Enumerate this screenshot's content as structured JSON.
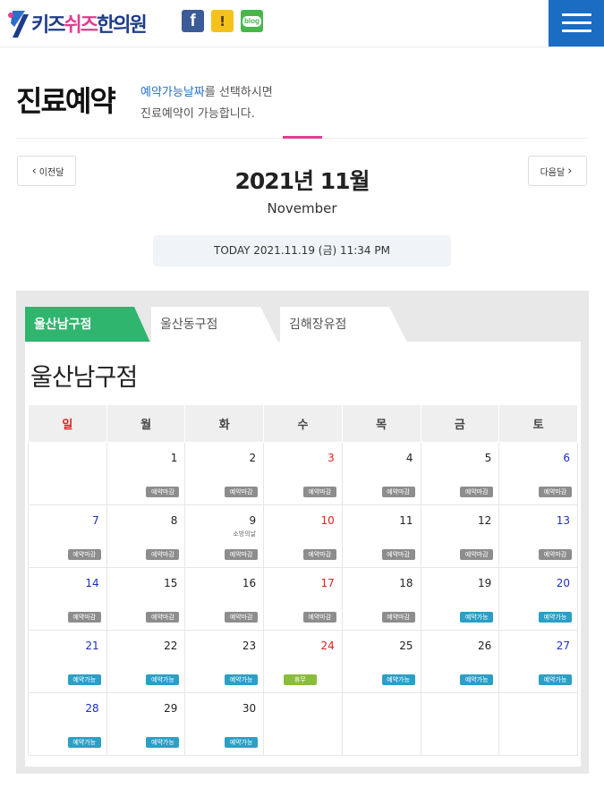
{
  "header": {
    "logo_a": "키즈",
    "logo_b": "쉬즈",
    "logo_c": "한의원",
    "facebook_glyph": "f",
    "story_glyph": "!",
    "blog_label": "blog",
    "icons": [
      "facebook-icon",
      "kakaostory-icon",
      "blog-icon",
      "hamburger-menu-icon"
    ],
    "brand_color": "#1f3c8a",
    "accent_color": "#e23c8e",
    "menu_color": "#1b6cc3"
  },
  "title": {
    "heading": "진료예약",
    "desc_highlight": "예약가능날짜",
    "desc_rest": "를 선택하시면",
    "desc_line2": "진료예약이 가능합니다."
  },
  "nav": {
    "prev_label": "이전달",
    "next_label": "다음달",
    "prev_icon": "chevron-left-icon",
    "next_icon": "chevron-right-icon",
    "month_title": "2021년 11월",
    "month_en": "November",
    "today": "TODAY 2021.11.19 (금) 11:34 PM"
  },
  "tabs": [
    {
      "label": "울산남구점",
      "active": true
    },
    {
      "label": "울산동구점",
      "active": false
    },
    {
      "label": "김해장유점",
      "active": false
    }
  ],
  "branch_title": "울산남구점",
  "weekdays": [
    "일",
    "월",
    "화",
    "수",
    "목",
    "금",
    "토"
  ],
  "status_labels": {
    "closed": "예약마감",
    "available": "예약가능",
    "off": "휴무"
  },
  "colors": {
    "available": "#2b9fc6",
    "closed": "#8d8d8d",
    "off": "#8bbd3c",
    "sunday": "#e02020",
    "saturday": "#1b2fc2",
    "active_tab": "#2fb56e"
  },
  "weeks": [
    [
      null,
      {
        "day": "1",
        "status": "closed"
      },
      {
        "day": "2",
        "status": "closed"
      },
      {
        "day": "3",
        "status": "closed",
        "holiday": true
      },
      {
        "day": "4",
        "status": "closed"
      },
      {
        "day": "5",
        "status": "closed"
      },
      {
        "day": "6",
        "status": "closed"
      }
    ],
    [
      {
        "day": "7",
        "status": "closed",
        "blue": true
      },
      {
        "day": "8",
        "status": "closed"
      },
      {
        "day": "9",
        "status": "closed",
        "note": "소방의날"
      },
      {
        "day": "10",
        "status": "closed",
        "holiday": true
      },
      {
        "day": "11",
        "status": "closed"
      },
      {
        "day": "12",
        "status": "closed"
      },
      {
        "day": "13",
        "status": "closed"
      }
    ],
    [
      {
        "day": "14",
        "status": "closed",
        "blue": true
      },
      {
        "day": "15",
        "status": "closed"
      },
      {
        "day": "16",
        "status": "closed"
      },
      {
        "day": "17",
        "status": "closed",
        "holiday": true
      },
      {
        "day": "18",
        "status": "closed"
      },
      {
        "day": "19",
        "status": "available"
      },
      {
        "day": "20",
        "status": "available"
      }
    ],
    [
      {
        "day": "21",
        "status": "available",
        "blue": true
      },
      {
        "day": "22",
        "status": "available"
      },
      {
        "day": "23",
        "status": "available"
      },
      {
        "day": "24",
        "status": "off",
        "holiday": true
      },
      {
        "day": "25",
        "status": "available"
      },
      {
        "day": "26",
        "status": "available"
      },
      {
        "day": "27",
        "status": "available"
      }
    ],
    [
      {
        "day": "28",
        "status": "available",
        "blue": true
      },
      {
        "day": "29",
        "status": "available"
      },
      {
        "day": "30",
        "status": "available"
      },
      null,
      null,
      null,
      null
    ]
  ]
}
